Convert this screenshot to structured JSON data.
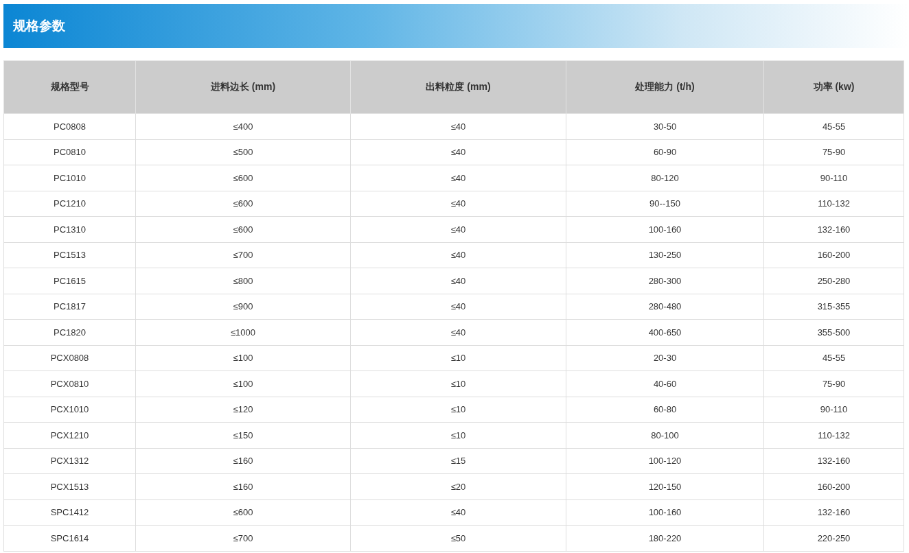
{
  "section": {
    "title": "规格参数"
  },
  "table": {
    "columns": [
      "规格型号",
      "进料边长 (mm)",
      "出料粒度 (mm)",
      "处理能力 (t/h)",
      "功率 (kw)"
    ],
    "rows": [
      [
        "PC0808",
        "≤400",
        "≤40",
        "30-50",
        "45-55"
      ],
      [
        "PC0810",
        "≤500",
        "≤40",
        "60-90",
        "75-90"
      ],
      [
        "PC1010",
        "≤600",
        "≤40",
        "80-120",
        "90-110"
      ],
      [
        "PC1210",
        "≤600",
        "≤40",
        "90--150",
        "110-132"
      ],
      [
        "PC1310",
        "≤600",
        "≤40",
        "100-160",
        "132-160"
      ],
      [
        "PC1513",
        "≤700",
        "≤40",
        "130-250",
        "160-200"
      ],
      [
        "PC1615",
        "≤800",
        "≤40",
        "280-300",
        "250-280"
      ],
      [
        "PC1817",
        "≤900",
        "≤40",
        "280-480",
        "315-355"
      ],
      [
        "PC1820",
        "≤1000",
        "≤40",
        "400-650",
        "355-500"
      ],
      [
        "PCX0808",
        "≤100",
        "≤10",
        "20-30",
        "45-55"
      ],
      [
        "PCX0810",
        "≤100",
        "≤10",
        "40-60",
        "75-90"
      ],
      [
        "PCX1010",
        "≤120",
        "≤10",
        "60-80",
        "90-110"
      ],
      [
        "PCX1210",
        "≤150",
        "≤10",
        "80-100",
        "110-132"
      ],
      [
        "PCX1312",
        "≤160",
        "≤15",
        "100-120",
        "132-160"
      ],
      [
        "PCX1513",
        "≤160",
        "≤20",
        "120-150",
        "160-200"
      ],
      [
        "SPC1412",
        "≤600",
        "≤40",
        "100-160",
        "132-160"
      ],
      [
        "SPC1614",
        "≤700",
        "≤50",
        "180-220",
        "220-250"
      ]
    ]
  }
}
